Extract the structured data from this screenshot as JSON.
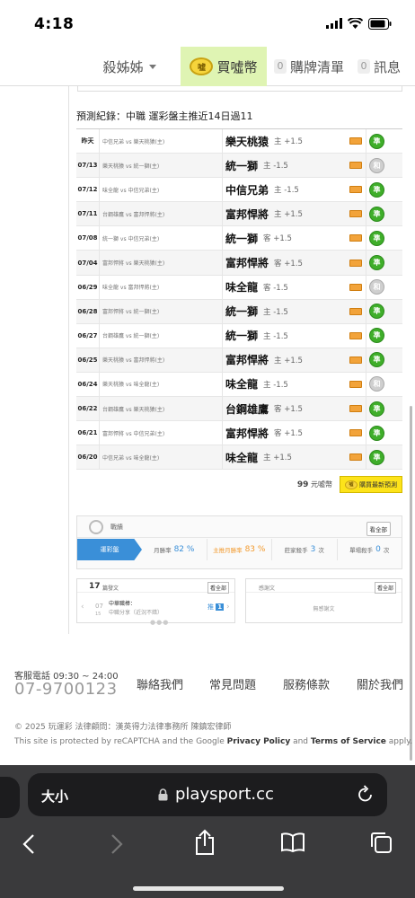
{
  "status": {
    "time": "4:18"
  },
  "nav": {
    "user": "殺姊姊",
    "buy_label": "買噓幣",
    "coin_glyph": "噓",
    "cart_count": "0",
    "cart_label": "購牌清單",
    "msg_count": "0",
    "msg_label": "訊息"
  },
  "record": {
    "title": "預測紀錄：中職 運彩盤主推近14日過11",
    "rows": [
      {
        "date": "昨天",
        "match": "中信兄弟 vs 樂天桃猿(主)",
        "team": "樂天桃猿",
        "side": "主 +1.5",
        "result": "win",
        "res_glyph": "準"
      },
      {
        "date": "07/13",
        "match": "樂天桃猿 vs 統一獅(主)",
        "team": "統一獅",
        "side": "主 -1.5",
        "result": "draw",
        "res_glyph": "和"
      },
      {
        "date": "07/12",
        "match": "味全龍 vs 中信兄弟(主)",
        "team": "中信兄弟",
        "side": "主 -1.5",
        "result": "win",
        "res_glyph": "準"
      },
      {
        "date": "07/11",
        "match": "台鋼雄鷹 vs 富邦悍將(主)",
        "team": "富邦悍將",
        "side": "主 +1.5",
        "result": "win",
        "res_glyph": "準"
      },
      {
        "date": "07/08",
        "match": "統一獅 vs 中信兄弟(主)",
        "team": "統一獅",
        "side": "客 +1.5",
        "result": "win",
        "res_glyph": "準"
      },
      {
        "date": "07/04",
        "match": "富邦悍將 vs 樂天桃猿(主)",
        "team": "富邦悍將",
        "side": "客 +1.5",
        "result": "win",
        "res_glyph": "準"
      },
      {
        "date": "06/29",
        "match": "味全龍 vs 富邦悍將(主)",
        "team": "味全龍",
        "side": "客 -1.5",
        "result": "draw",
        "res_glyph": "和"
      },
      {
        "date": "06/28",
        "match": "富邦悍將 vs 統一獅(主)",
        "team": "統一獅",
        "side": "主 -1.5",
        "result": "win",
        "res_glyph": "準"
      },
      {
        "date": "06/27",
        "match": "台鋼雄鷹 vs 統一獅(主)",
        "team": "統一獅",
        "side": "主 -1.5",
        "result": "win",
        "res_glyph": "準"
      },
      {
        "date": "06/25",
        "match": "樂天桃猿 vs 富邦悍將(主)",
        "team": "富邦悍將",
        "side": "主 +1.5",
        "result": "win",
        "res_glyph": "準"
      },
      {
        "date": "06/24",
        "match": "樂天桃猿 vs 味全龍(主)",
        "team": "味全龍",
        "side": "主 -1.5",
        "result": "draw",
        "res_glyph": "和"
      },
      {
        "date": "06/22",
        "match": "台鋼雄鷹 vs 樂天桃猿(主)",
        "team": "台鋼雄鷹",
        "side": "客 +1.5",
        "result": "win",
        "res_glyph": "準"
      },
      {
        "date": "06/21",
        "match": "富邦悍將 vs 中信兄弟(主)",
        "team": "富邦悍將",
        "side": "客 +1.5",
        "result": "win",
        "res_glyph": "準"
      },
      {
        "date": "06/20",
        "match": "中信兄弟 vs 味全龍(主)",
        "team": "味全龍",
        "side": "主 +1.5",
        "result": "win",
        "res_glyph": "準"
      }
    ]
  },
  "buy": {
    "price": "99",
    "price_unit": "元噓幣",
    "button": "購買最新預測"
  },
  "stats": {
    "label": "戰績",
    "view_all": "看全部",
    "tab": "運彩盤",
    "monthly_label": "月勝率",
    "monthly_value": "82 %",
    "main_label": "主推月勝率",
    "main_value": "83 %",
    "streak_label": "莊家殺手",
    "streak_value": "3",
    "streak_unit": "次",
    "single_label": "單場殺手",
    "single_value": "0",
    "single_unit": "次"
  },
  "posts": {
    "count": "17",
    "title": "篇發文",
    "view_all": "看全部",
    "date_month": "07",
    "date_day": "15",
    "post_title": "中華職棒：",
    "post_sub": "中職分享（近況不錯）",
    "page_prefix": "推",
    "page_num": "1"
  },
  "replies": {
    "title": "感謝文",
    "view_all": "看全部",
    "empty": "無感謝文"
  },
  "footer": {
    "hotline_label": "客服電話 09:30 ~ 24:00",
    "hotline": "07-9700123",
    "links": [
      "聯絡我們",
      "常見問題",
      "服務條款",
      "關於我們"
    ],
    "copyright": "© 2025 玩運彩  法律顧問：漢英得力法律事務所 陳鎮宏律師",
    "recaptcha_pre": "This site is protected by reCAPTCHA and the Google ",
    "privacy": "Privacy Policy",
    "and": " and ",
    "terms": "Terms of Service",
    "apply": " apply."
  },
  "browser": {
    "text_size": "大小",
    "url": "playsport.cc"
  }
}
